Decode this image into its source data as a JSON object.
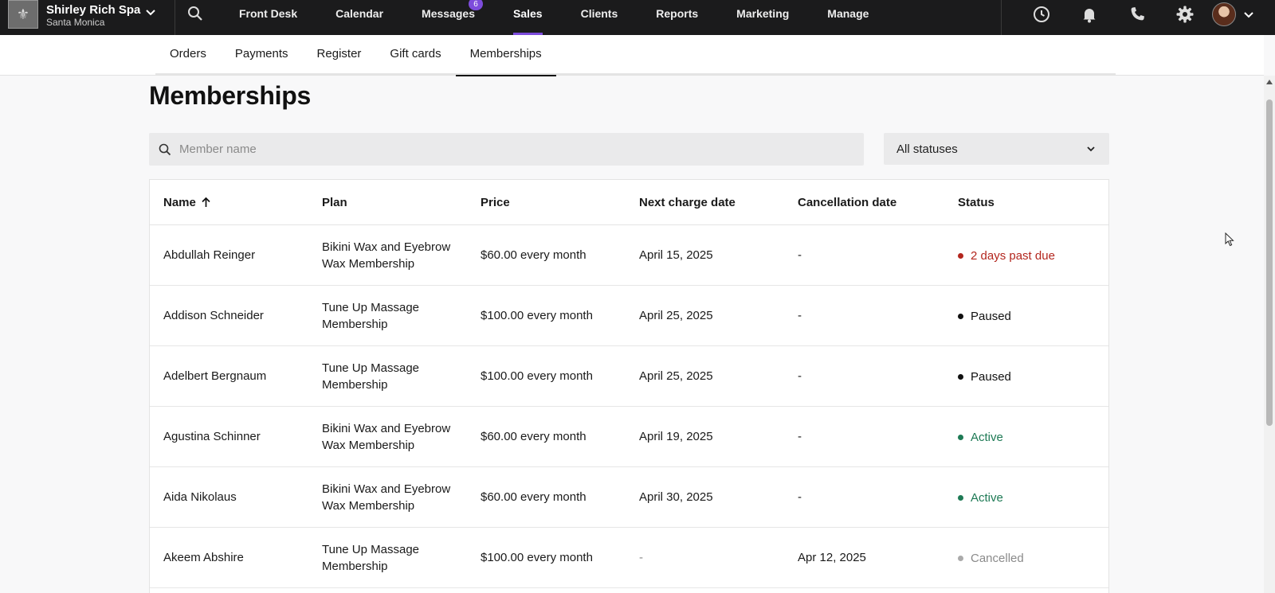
{
  "brand": {
    "name": "Shirley Rich Spa",
    "location": "Santa Monica"
  },
  "nav": {
    "items": [
      {
        "label": "Front Desk"
      },
      {
        "label": "Calendar"
      },
      {
        "label": "Messages",
        "badge": "6"
      },
      {
        "label": "Sales",
        "active": true
      },
      {
        "label": "Clients"
      },
      {
        "label": "Reports"
      },
      {
        "label": "Marketing"
      },
      {
        "label": "Manage"
      }
    ]
  },
  "subnav": {
    "tabs": [
      {
        "label": "Orders"
      },
      {
        "label": "Payments"
      },
      {
        "label": "Register"
      },
      {
        "label": "Gift cards"
      },
      {
        "label": "Memberships",
        "active": true
      }
    ]
  },
  "page": {
    "title": "Memberships",
    "search_placeholder": "Member name",
    "status_filter": "All statuses"
  },
  "table": {
    "headers": {
      "name": "Name",
      "plan": "Plan",
      "price": "Price",
      "next_charge": "Next charge date",
      "cancellation": "Cancellation date",
      "status": "Status"
    },
    "rows": [
      {
        "name": "Abdullah Reinger",
        "plan": "Bikini Wax and Eyebrow Wax Membership",
        "price": "$60.00 every month",
        "next_charge": "April 15, 2025",
        "cancellation": "-",
        "status": "2 days past due"
      },
      {
        "name": "Addison Schneider",
        "plan": "Tune Up Massage Membership",
        "price": "$100.00 every month",
        "next_charge": "April 25, 2025",
        "cancellation": "-",
        "status": "Paused"
      },
      {
        "name": "Adelbert Bergnaum",
        "plan": "Tune Up Massage Membership",
        "price": "$100.00 every month",
        "next_charge": "April 25, 2025",
        "cancellation": "-",
        "status": "Paused"
      },
      {
        "name": "Agustina Schinner",
        "plan": "Bikini Wax and Eyebrow Wax Membership",
        "price": "$60.00 every month",
        "next_charge": "April 19, 2025",
        "cancellation": "-",
        "status": "Active"
      },
      {
        "name": "Aida Nikolaus",
        "plan": "Bikini Wax and Eyebrow Wax Membership",
        "price": "$60.00 every month",
        "next_charge": "April 30, 2025",
        "cancellation": "-",
        "status": "Active"
      },
      {
        "name": "Akeem Abshire",
        "plan": "Tune Up Massage Membership",
        "price": "$100.00 every month",
        "next_charge": "-",
        "cancellation": "Apr 12, 2025",
        "status": "Cancelled"
      }
    ]
  },
  "colors": {
    "accent": "#7d4cdb",
    "past_due": "#b3261e",
    "paused": "#111111",
    "active": "#1e7a55",
    "cancelled": "#8a8a8a"
  }
}
